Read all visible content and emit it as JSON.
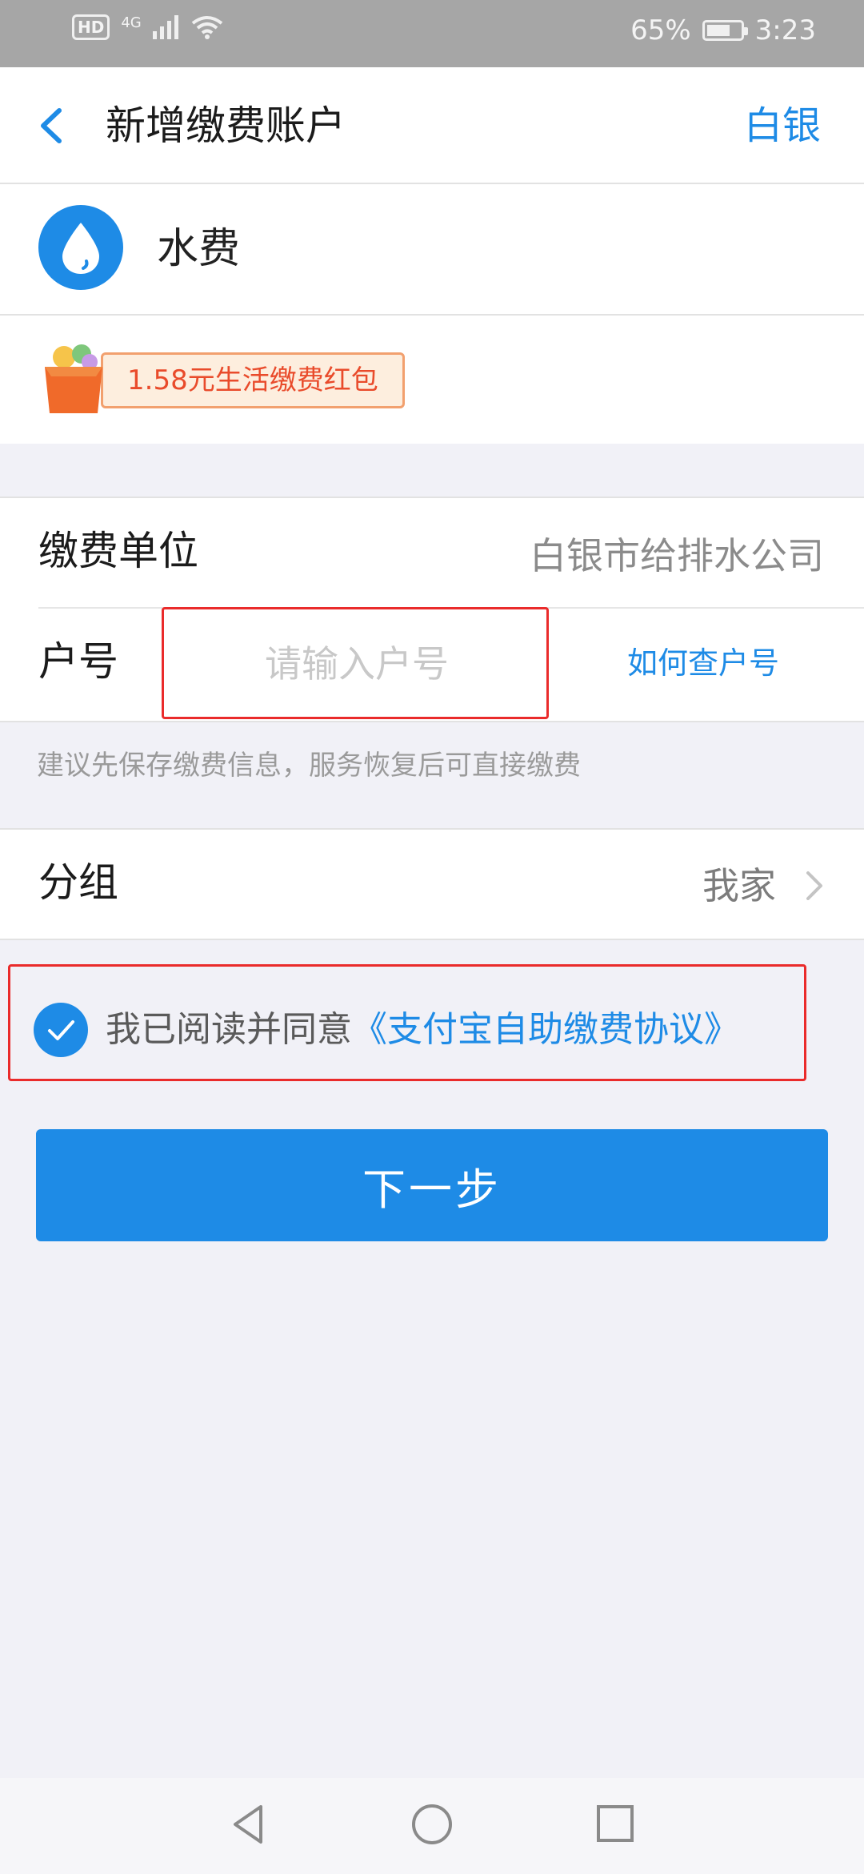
{
  "status_bar": {
    "network": "4G",
    "hd": "HD",
    "battery": "65%",
    "time": "3:23"
  },
  "nav": {
    "title": "新增缴费账户",
    "city": "白银"
  },
  "service": {
    "name": "水费",
    "icon": "water-drop-icon"
  },
  "promo": {
    "label": "1.58元生活缴费红包"
  },
  "form": {
    "unit_label": "缴费单位",
    "unit_value": "白银市给排水公司",
    "account_label": "户号",
    "account_placeholder": "请输入户号",
    "help_link": "如何查户号"
  },
  "hint": "建议先保存缴费信息，服务恢复后可直接缴费",
  "group": {
    "label": "分组",
    "value": "我家"
  },
  "agreement": {
    "text": "我已阅读并同意",
    "link": "《支付宝自助缴费协议》",
    "checked": true
  },
  "next_button": "下一步",
  "colors": {
    "accent": "#1e8be6",
    "highlight": "#ea2b2b",
    "promo": "#e94b2b"
  }
}
